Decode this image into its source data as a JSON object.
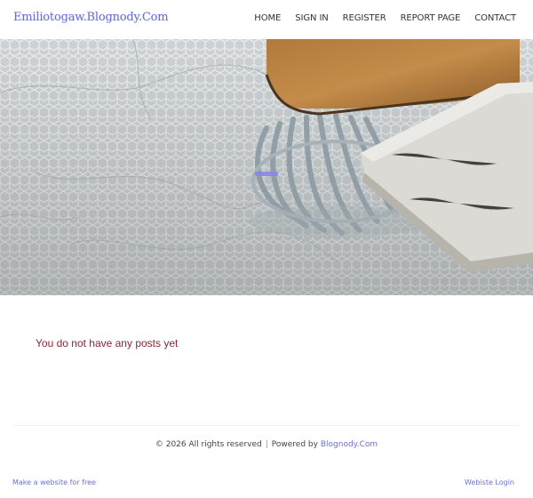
{
  "header": {
    "site_title": "Emiliotogaw.Blognody.Com",
    "nav": [
      {
        "label": "HOME"
      },
      {
        "label": "SIGN IN"
      },
      {
        "label": "REGISTER"
      },
      {
        "label": "REPORT PAGE"
      },
      {
        "label": "CONTACT"
      }
    ]
  },
  "hero": {
    "image": "chair-on-hexagonal-tile-floor"
  },
  "main": {
    "empty_message": "You do not have any posts yet"
  },
  "footer": {
    "copyright_text": "© 2026 All rights reserved",
    "separator": "|",
    "powered_by_label": "Powered by",
    "powered_by_link": "Blognody.Com",
    "make_website_link": "Make a website for free",
    "website_login_link": "Webiste Login"
  },
  "colors": {
    "accent": "#6b6fd6",
    "message": "#8a2534",
    "text": "#333333"
  }
}
